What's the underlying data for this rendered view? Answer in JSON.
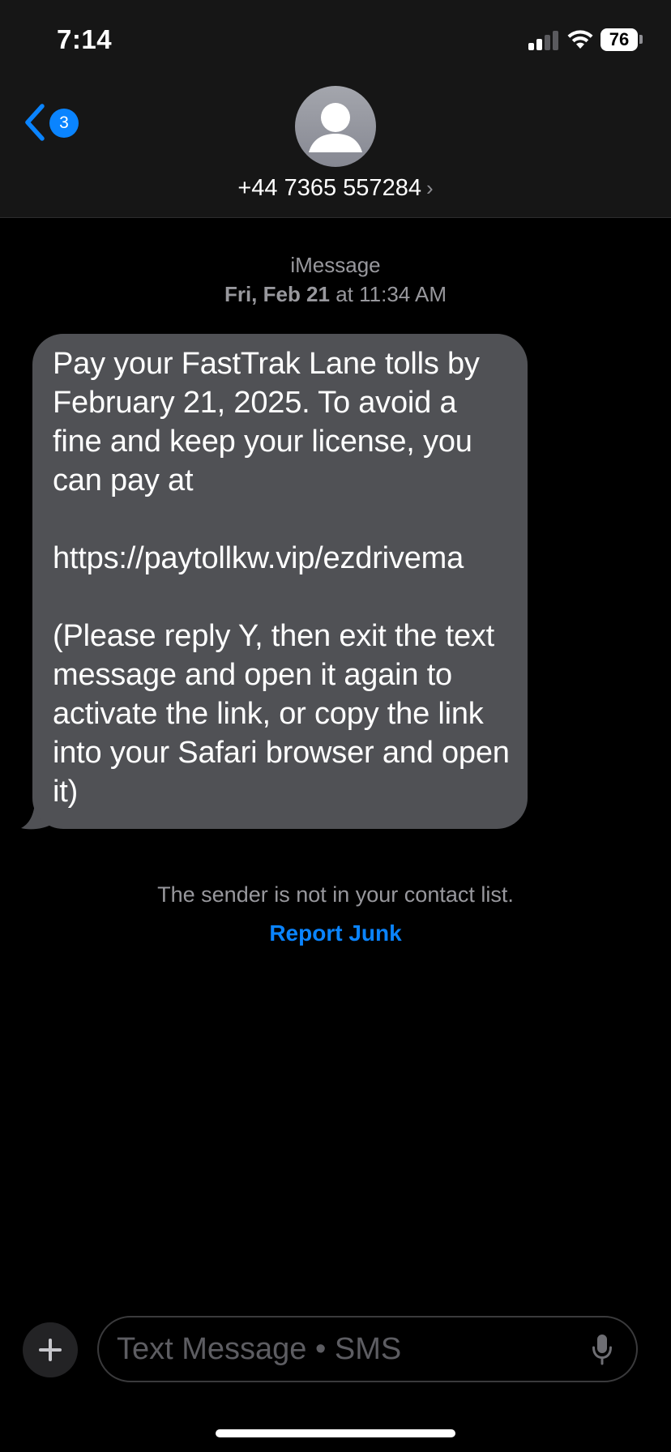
{
  "status_bar": {
    "time": "7:14",
    "battery": "76"
  },
  "header": {
    "back_badge_count": "3",
    "contact_number": "+44 7365 557284",
    "contact_chevron": "›"
  },
  "conversation": {
    "service": "iMessage",
    "timestamp_day": "Fri, Feb 21",
    "timestamp_time": " at 11:34 AM",
    "message_text": "Pay your FastTrak Lane tolls by February 21, 2025. To avoid a fine and keep your license, you can pay at\n\nhttps://paytollkw.vip/ezdrivema\n\n(Please reply Y, then exit the text message and open it again to activate the link, or copy the link into your Safari browser and open it)",
    "sender_notice": "The sender is not in your contact list.",
    "report_junk_label": "Report Junk"
  },
  "composer": {
    "placeholder": "Text Message • SMS"
  },
  "colors": {
    "accent": "#0a84ff",
    "bubble_incoming": "#505155",
    "background": "#000000",
    "header_background": "#161616"
  },
  "icons": {
    "back": "chevron-left-icon",
    "avatar": "person-silhouette-icon",
    "add": "plus-icon",
    "dictation": "microphone-icon",
    "signal": "cellular-signal-icon",
    "wifi": "wifi-icon",
    "battery": "battery-icon"
  }
}
